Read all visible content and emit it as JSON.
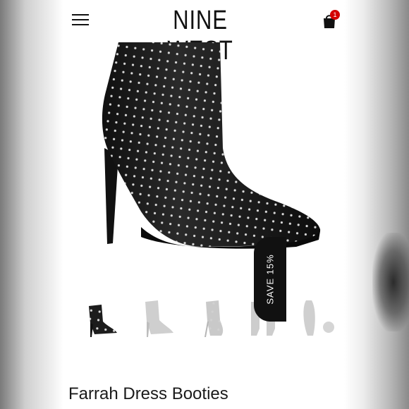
{
  "header": {
    "brand": "NINE WEST",
    "cart_count": "1"
  },
  "promo": {
    "label": "SAVE 15%"
  },
  "product": {
    "title": "Farrah Dress Booties"
  },
  "thumbnails": [
    "Black studded bootie",
    "Grey bootie",
    "Grey patterned bootie",
    "Bootie pair",
    "Bootie top view"
  ],
  "colors": {
    "badge": "#d40000",
    "promo_bg": "#111111",
    "leather": "#1c1c1c"
  }
}
